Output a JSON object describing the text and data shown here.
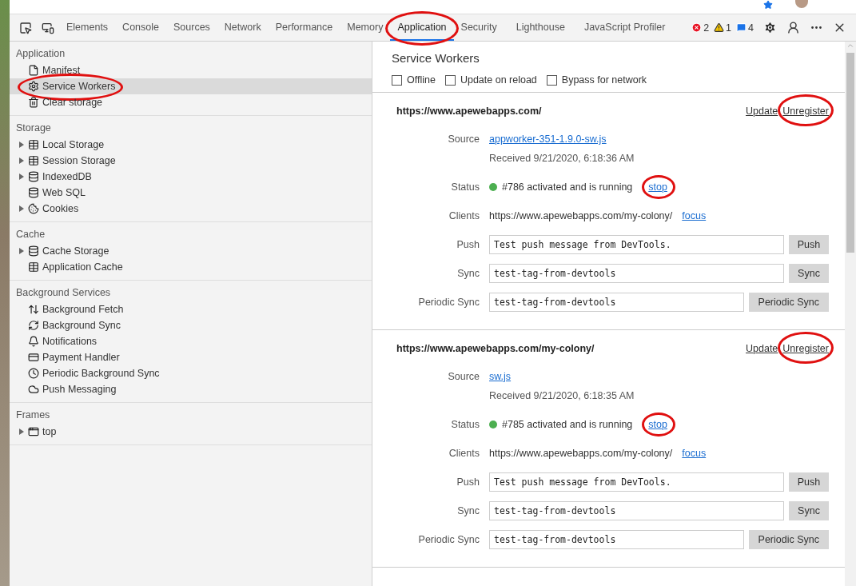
{
  "toolbar": {
    "tabs": [
      {
        "label": "Elements",
        "selected": false,
        "circled": false
      },
      {
        "label": "Console",
        "selected": false,
        "circled": false
      },
      {
        "label": "Sources",
        "selected": false,
        "circled": false
      },
      {
        "label": "Network",
        "selected": false,
        "circled": false
      },
      {
        "label": "Performance",
        "selected": false,
        "circled": false
      },
      {
        "label": "Memory",
        "selected": false,
        "circled": false
      },
      {
        "label": "Application",
        "selected": true,
        "circled": true
      },
      {
        "label": "Security",
        "selected": false,
        "circled": false
      },
      {
        "label": "Lighthouse",
        "selected": false,
        "circled": false
      },
      {
        "label": "JavaScript Profiler",
        "selected": false,
        "circled": false
      }
    ],
    "counters": [
      {
        "kind": "error",
        "count": "2"
      },
      {
        "kind": "warning",
        "count": "1"
      },
      {
        "kind": "info",
        "count": "4"
      }
    ]
  },
  "sidebar": {
    "sections": [
      {
        "title": "Application",
        "items": [
          {
            "label": "Manifest",
            "expandable": false,
            "selected": false,
            "circled": false
          },
          {
            "label": "Service Workers",
            "expandable": false,
            "selected": true,
            "circled": true
          },
          {
            "label": "Clear storage",
            "expandable": false,
            "selected": false,
            "circled": false
          }
        ]
      },
      {
        "title": "Storage",
        "items": [
          {
            "label": "Local Storage",
            "expandable": true,
            "selected": false,
            "circled": false
          },
          {
            "label": "Session Storage",
            "expandable": true,
            "selected": false,
            "circled": false
          },
          {
            "label": "IndexedDB",
            "expandable": true,
            "selected": false,
            "circled": false
          },
          {
            "label": "Web SQL",
            "expandable": false,
            "selected": false,
            "circled": false
          },
          {
            "label": "Cookies",
            "expandable": true,
            "selected": false,
            "circled": false
          }
        ]
      },
      {
        "title": "Cache",
        "items": [
          {
            "label": "Cache Storage",
            "expandable": true,
            "selected": false,
            "circled": false
          },
          {
            "label": "Application Cache",
            "expandable": false,
            "selected": false,
            "circled": false
          }
        ]
      },
      {
        "title": "Background Services",
        "items": [
          {
            "label": "Background Fetch",
            "expandable": false,
            "selected": false,
            "circled": false
          },
          {
            "label": "Background Sync",
            "expandable": false,
            "selected": false,
            "circled": false
          },
          {
            "label": "Notifications",
            "expandable": false,
            "selected": false,
            "circled": false
          },
          {
            "label": "Payment Handler",
            "expandable": false,
            "selected": false,
            "circled": false
          },
          {
            "label": "Periodic Background Sync",
            "expandable": false,
            "selected": false,
            "circled": false
          },
          {
            "label": "Push Messaging",
            "expandable": false,
            "selected": false,
            "circled": false
          }
        ]
      },
      {
        "title": "Frames",
        "items": [
          {
            "label": "top",
            "expandable": true,
            "selected": false,
            "circled": false
          }
        ]
      }
    ]
  },
  "panel": {
    "title": "Service Workers",
    "options": [
      {
        "label": "Offline",
        "checked": false
      },
      {
        "label": "Update on reload",
        "checked": false
      },
      {
        "label": "Bypass for network",
        "checked": false
      }
    ],
    "workers": [
      {
        "scope": "https://www.apewebapps.com/",
        "actions": [
          {
            "label": "Update",
            "circled": false
          },
          {
            "label": "Unregister",
            "circled": true
          }
        ],
        "source": "appworker-351-1.9.0-sw.js",
        "received": "Received 9/21/2020, 6:18:36 AM",
        "status": {
          "color": "#4caf50",
          "text": "#786 activated and is running",
          "action": "stop",
          "circled": true
        },
        "clients": {
          "url": "https://www.apewebapps.com/my-colony/",
          "action": "focus"
        },
        "labels": [
          "Source",
          "Status",
          "Clients"
        ],
        "inputs": [
          {
            "label": "Push",
            "value": "Test push message from DevTools.",
            "button": "Push"
          },
          {
            "label": "Sync",
            "value": "test-tag-from-devtools",
            "button": "Sync"
          },
          {
            "label": "Periodic Sync",
            "value": "test-tag-from-devtools",
            "button": "Periodic Sync"
          }
        ]
      },
      {
        "scope": "https://www.apewebapps.com/my-colony/",
        "actions": [
          {
            "label": "Update",
            "circled": false
          },
          {
            "label": "Unregister",
            "circled": true
          }
        ],
        "source": "sw.js",
        "received": "Received 9/21/2020, 6:18:35 AM",
        "status": {
          "color": "#4caf50",
          "text": "#785 activated and is running",
          "action": "stop",
          "circled": true
        },
        "clients": {
          "url": "https://www.apewebapps.com/my-colony/",
          "action": "focus"
        },
        "labels": [
          "Source",
          "Status",
          "Clients"
        ],
        "inputs": [
          {
            "label": "Push",
            "value": "Test push message from DevTools.",
            "button": "Push"
          },
          {
            "label": "Sync",
            "value": "test-tag-from-devtools",
            "button": "Sync"
          },
          {
            "label": "Periodic Sync",
            "value": "test-tag-from-devtools",
            "button": "Periodic Sync"
          }
        ]
      }
    ]
  }
}
